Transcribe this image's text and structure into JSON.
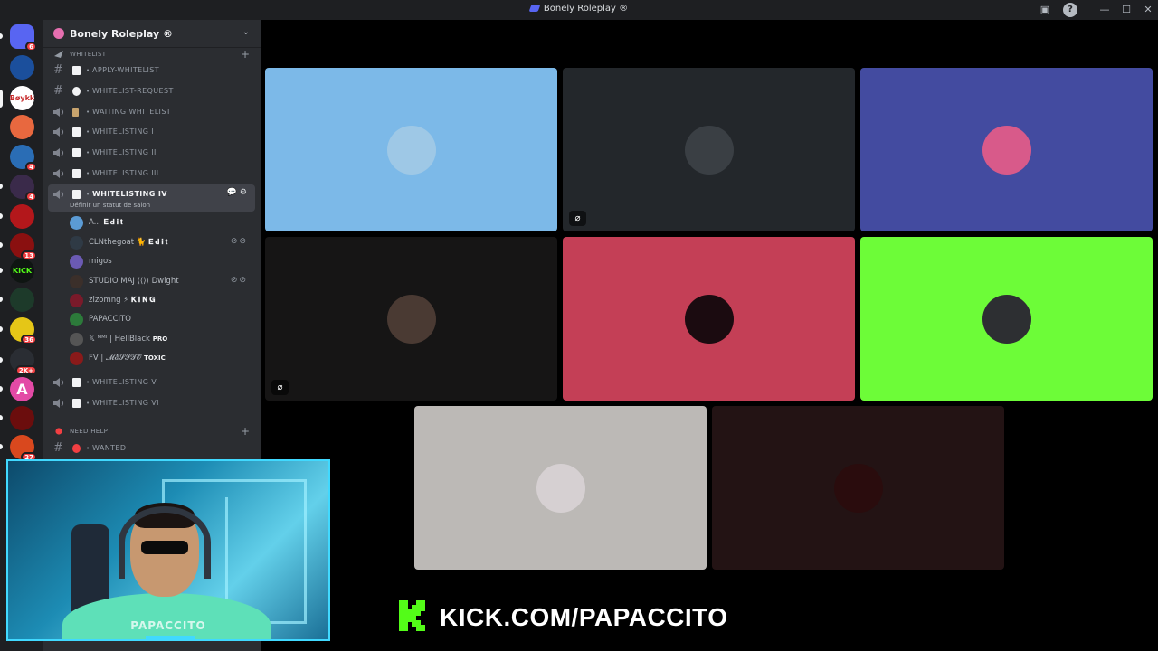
{
  "window": {
    "title": "Bonely Roleplay ®"
  },
  "server": {
    "name": "Bonely Roleplay ®"
  },
  "rail": {
    "servers": [
      {
        "name": "discord-home",
        "label": "",
        "color": "#5865f2",
        "badge": "6"
      },
      {
        "name": "server-2",
        "label": "",
        "color": "#1b4f9c",
        "badge": ""
      },
      {
        "name": "server-bayak",
        "label": "Bøykk",
        "color": "#ffffff",
        "badge": ""
      },
      {
        "name": "server-4",
        "label": "",
        "color": "#e8683f",
        "badge": ""
      },
      {
        "name": "server-5",
        "label": "",
        "color": "#2a6db5",
        "badge": "4"
      },
      {
        "name": "server-6",
        "label": "",
        "color": "#3a2a4a",
        "badge": "4"
      },
      {
        "name": "server-7",
        "label": "",
        "color": "#b3171b",
        "badge": ""
      },
      {
        "name": "server-8",
        "label": "",
        "color": "#8a1010",
        "badge": "13"
      },
      {
        "name": "server-kick",
        "label": "KICK",
        "color": "#0f1512",
        "badge": ""
      },
      {
        "name": "server-10",
        "label": "",
        "color": "#1d3a2a",
        "badge": ""
      },
      {
        "name": "server-11",
        "label": "",
        "color": "#e5c617",
        "badge": "36"
      },
      {
        "name": "server-12",
        "label": "",
        "color": "#2a2d33",
        "badge": "2K+"
      },
      {
        "name": "server-13",
        "label": "A",
        "color": "#e34aa6",
        "badge": ""
      },
      {
        "name": "server-14",
        "label": "",
        "color": "#6b0d0d",
        "badge": ""
      },
      {
        "name": "server-15",
        "label": "",
        "color": "#d9481e",
        "badge": "27"
      }
    ]
  },
  "categories": {
    "whitelist": "WHITELIST",
    "need_help": "NEED HELP"
  },
  "channels": [
    {
      "type": "text",
      "name": "APPLY-WHITELIST"
    },
    {
      "type": "text",
      "name": "WHITELIST-REQUEST"
    },
    {
      "type": "voice",
      "name": "WAITING WHITELIST"
    },
    {
      "type": "voice",
      "name": "WHITELISTING I"
    },
    {
      "type": "voice",
      "name": "WHITELISTING II"
    },
    {
      "type": "voice",
      "name": "WHITELISTING III"
    },
    {
      "type": "voice",
      "name": "WHITELISTING IV",
      "status": "Définir un statut de salon"
    },
    {
      "type": "voice",
      "name": "WHITELISTING V"
    },
    {
      "type": "voice",
      "name": "WHITELISTING VI"
    },
    {
      "type": "text",
      "name": "WANTED"
    }
  ],
  "voice_users": [
    {
      "name": "A...",
      "tag": "𝐄𝐝𝐢𝐭",
      "color": "#5b9bd5",
      "muted": false
    },
    {
      "name": "CLNthegoat 🐈",
      "tag": "𝐄𝐝𝐢𝐭",
      "color": "#2f3a45",
      "muted": true
    },
    {
      "name": "migos",
      "tag": "",
      "color": "#6b5ab3",
      "muted": false
    },
    {
      "name": "STUDIO MAJ  ⟨⟨⟩⟩ Dwight",
      "tag": "",
      "color": "#3b2f2a",
      "muted": true
    },
    {
      "name": "zizomng ⚡",
      "tag": "𝐊𝐈𝐍𝐆",
      "color": "#7a1a2a",
      "muted": false
    },
    {
      "name": "PAPACCITO",
      "tag": "",
      "color": "#2c7a3a",
      "muted": false
    },
    {
      "name": "𝕏 ᴹᴹᴵ | HellBlack",
      "tag": "PRO",
      "color": "#555",
      "muted": false
    },
    {
      "name": "FV | 𝓜𝓔𝓢𝓢𝓣𝓞",
      "tag": "TOXIC",
      "color": "#8a1a1a",
      "muted": false
    }
  ],
  "tiles": [
    {
      "name": "tile-1",
      "bg": "#7cb9e8",
      "avatar": "#9ec8e6",
      "cam_off": false
    },
    {
      "name": "tile-2",
      "bg": "#23272b",
      "avatar": "#3a3f44",
      "cam_off": true
    },
    {
      "name": "tile-3",
      "bg": "#434ba0",
      "avatar": "#d85a8a",
      "cam_off": false
    },
    {
      "name": "tile-4",
      "bg": "#161515",
      "avatar": "#4a3a33",
      "cam_off": true
    },
    {
      "name": "tile-5",
      "bg": "#c43f56",
      "avatar": "#1b0b10",
      "cam_off": false
    },
    {
      "name": "tile-6",
      "bg": "#6dfc38",
      "avatar": "#2d2f32",
      "cam_off": false
    },
    {
      "name": "tile-7",
      "bg": "#bcb9b6",
      "avatar": "#d6d0d2",
      "cam_off": false
    },
    {
      "name": "tile-8",
      "bg": "#231314",
      "avatar": "#2a0c0d",
      "cam_off": false
    }
  ],
  "webcam": {
    "watermark": "PAPACCITO"
  },
  "kick": {
    "url": "KICK.COM/PAPACCITO",
    "color": "#53fc18"
  }
}
